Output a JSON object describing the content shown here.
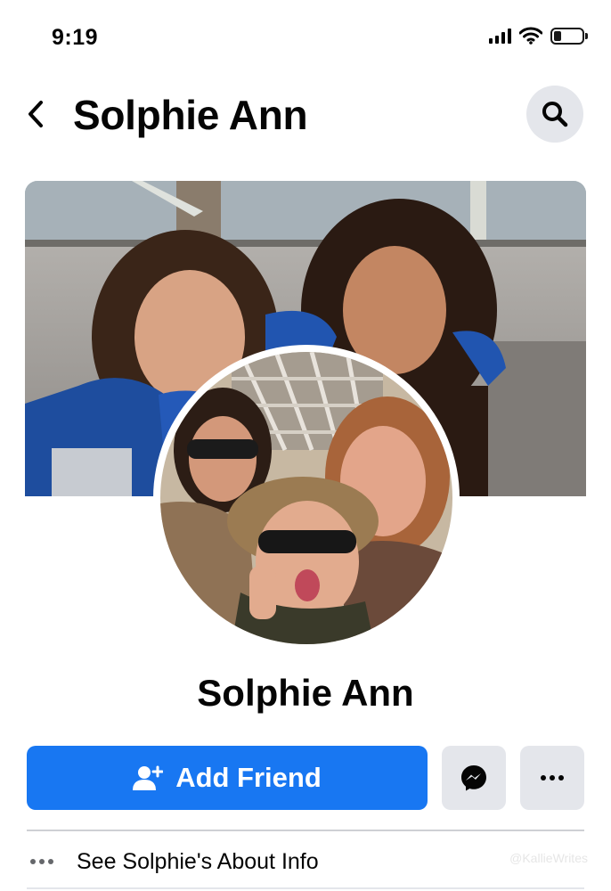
{
  "status_bar": {
    "time": "9:19",
    "icons": [
      "cellular-signal-icon",
      "wifi-icon",
      "battery-icon"
    ],
    "battery_level": 0.25
  },
  "header": {
    "title": "Solphie Ann",
    "back_icon": "chevron-left-icon",
    "search_icon": "search-icon"
  },
  "profile": {
    "name": "Solphie Ann",
    "cover_photo": "cover-photo",
    "profile_photo": "profile-photo"
  },
  "actions": {
    "add_friend_label": "Add Friend",
    "add_friend_icon": "add-friend-icon",
    "messenger_icon": "messenger-icon",
    "more_icon": "more-icon"
  },
  "about": {
    "label": "See Solphie's About Info",
    "icon": "more-icon"
  },
  "watermark": "@KallieWrites",
  "colors": {
    "primary": "#1877f2",
    "button_grey": "#e4e6eb",
    "text": "#050505",
    "secondary_text": "#65676b"
  }
}
